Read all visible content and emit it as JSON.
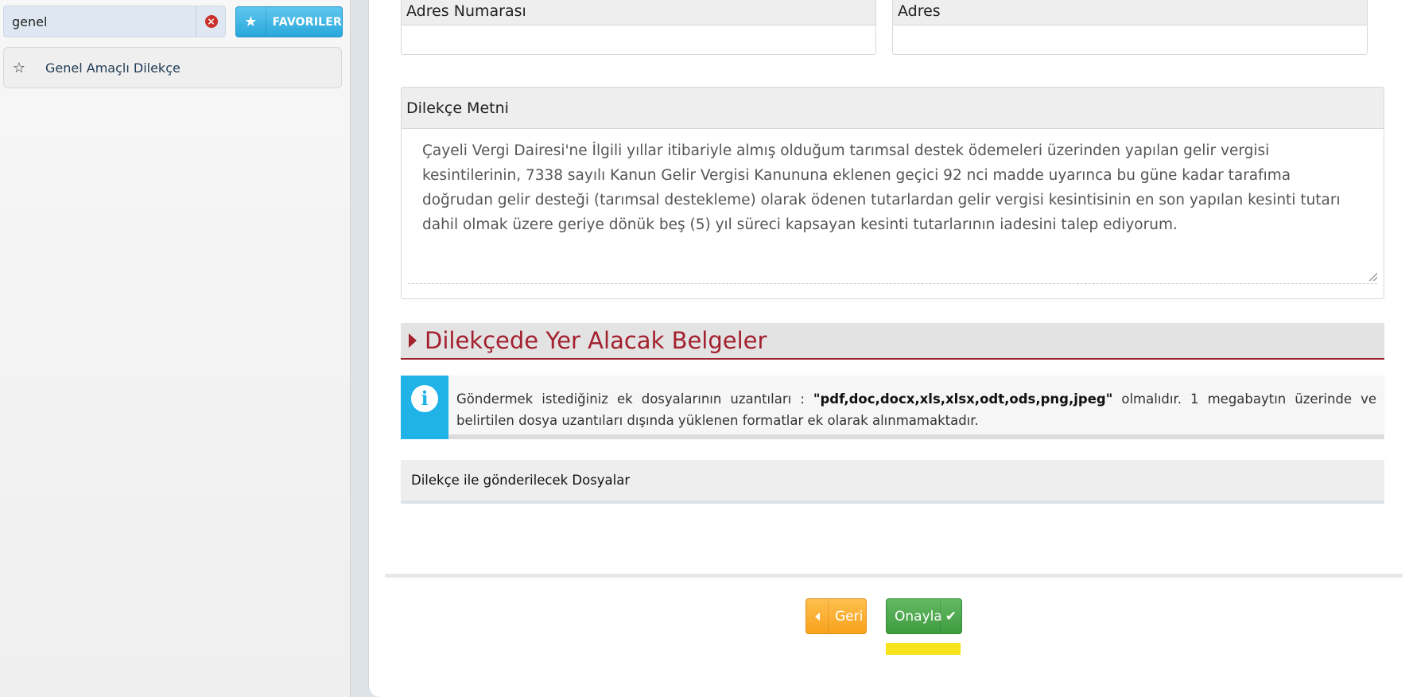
{
  "sidebar": {
    "search": {
      "value": "genel",
      "clear_icon": "close-circle-icon"
    },
    "favorites_button": {
      "label": "FAVORILER",
      "icon": "star-icon"
    },
    "items": [
      {
        "label": "Genel Amaçlı Dilekçe",
        "icon": "star-outline-icon"
      }
    ]
  },
  "form": {
    "address_number_label": "Adres Numarası",
    "address_label": "Adres",
    "petition_text_label": "Dilekçe Metni",
    "petition_text": "Çayeli Vergi Dairesi'ne İlgili yıllar itibariyle almış olduğum tarımsal destek ödemeleri üzerinden yapılan gelir vergisi kesintilerinin, 7338 sayılı Kanun Gelir Vergisi Kanununa eklenen geçici 92 nci madde uyarınca bu güne kadar tarafıma doğrudan gelir desteği (tarımsal destekleme) olarak ödenen tutarlardan gelir vergisi kesintisinin en son yapılan kesinti tutarı dahil olmak üzere geriye dönük beş (5) yıl süreci kapsayan kesinti tutarlarının iadesini talep ediyorum."
  },
  "documents": {
    "section_title": "Dilekçede Yer Alacak Belgeler",
    "info_prefix": "Göndermek istediğiniz ek dosyalarının uzantıları : ",
    "info_extensions": "\"pdf,doc,docx,xls,xlsx,odt,ods,png,jpeg\"",
    "info_suffix": " olmalıdır. 1 megabaytın üzerinde ve belirtilen dosya uzantıları dışında yüklenen formatlar ek olarak alınmamaktadır.",
    "files_header": "Dilekçe ile gönderilecek Dosyalar"
  },
  "actions": {
    "back_label": "Geri",
    "confirm_label": "Onayla"
  },
  "colors": {
    "accent_blue": "#2aa7db",
    "section_red": "#a3202e",
    "back_orange": "#f7a21d",
    "confirm_green": "#4aa84a",
    "highlight_yellow": "#f8e21a"
  }
}
